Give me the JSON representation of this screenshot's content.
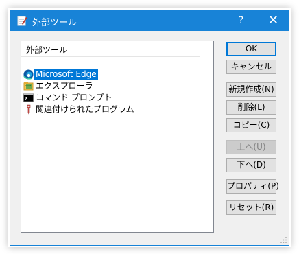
{
  "window": {
    "title": "外部ツール",
    "help_label": "?",
    "close_label": "✕",
    "accent": "#1883d7"
  },
  "list": {
    "column_header": "外部ツール",
    "items": [
      {
        "label": "Microsoft Edge",
        "icon": "edge-icon",
        "selected": true
      },
      {
        "label": "エクスプローラ",
        "icon": "explorer-folder-icon",
        "selected": false
      },
      {
        "label": "コマンド プロンプト",
        "icon": "command-prompt-icon",
        "selected": false
      },
      {
        "label": "関連付けられたプログラム",
        "icon": "associated-program-icon",
        "selected": false
      }
    ]
  },
  "buttons": {
    "ok": "OK",
    "cancel": "キャンセル",
    "new": "新規作成(N)",
    "delete": "削除(L)",
    "copy": "コピー(C)",
    "up": "上へ(U)",
    "down": "下へ(D)",
    "properties": "プロパティ(P)",
    "reset": "リセット(R)"
  }
}
